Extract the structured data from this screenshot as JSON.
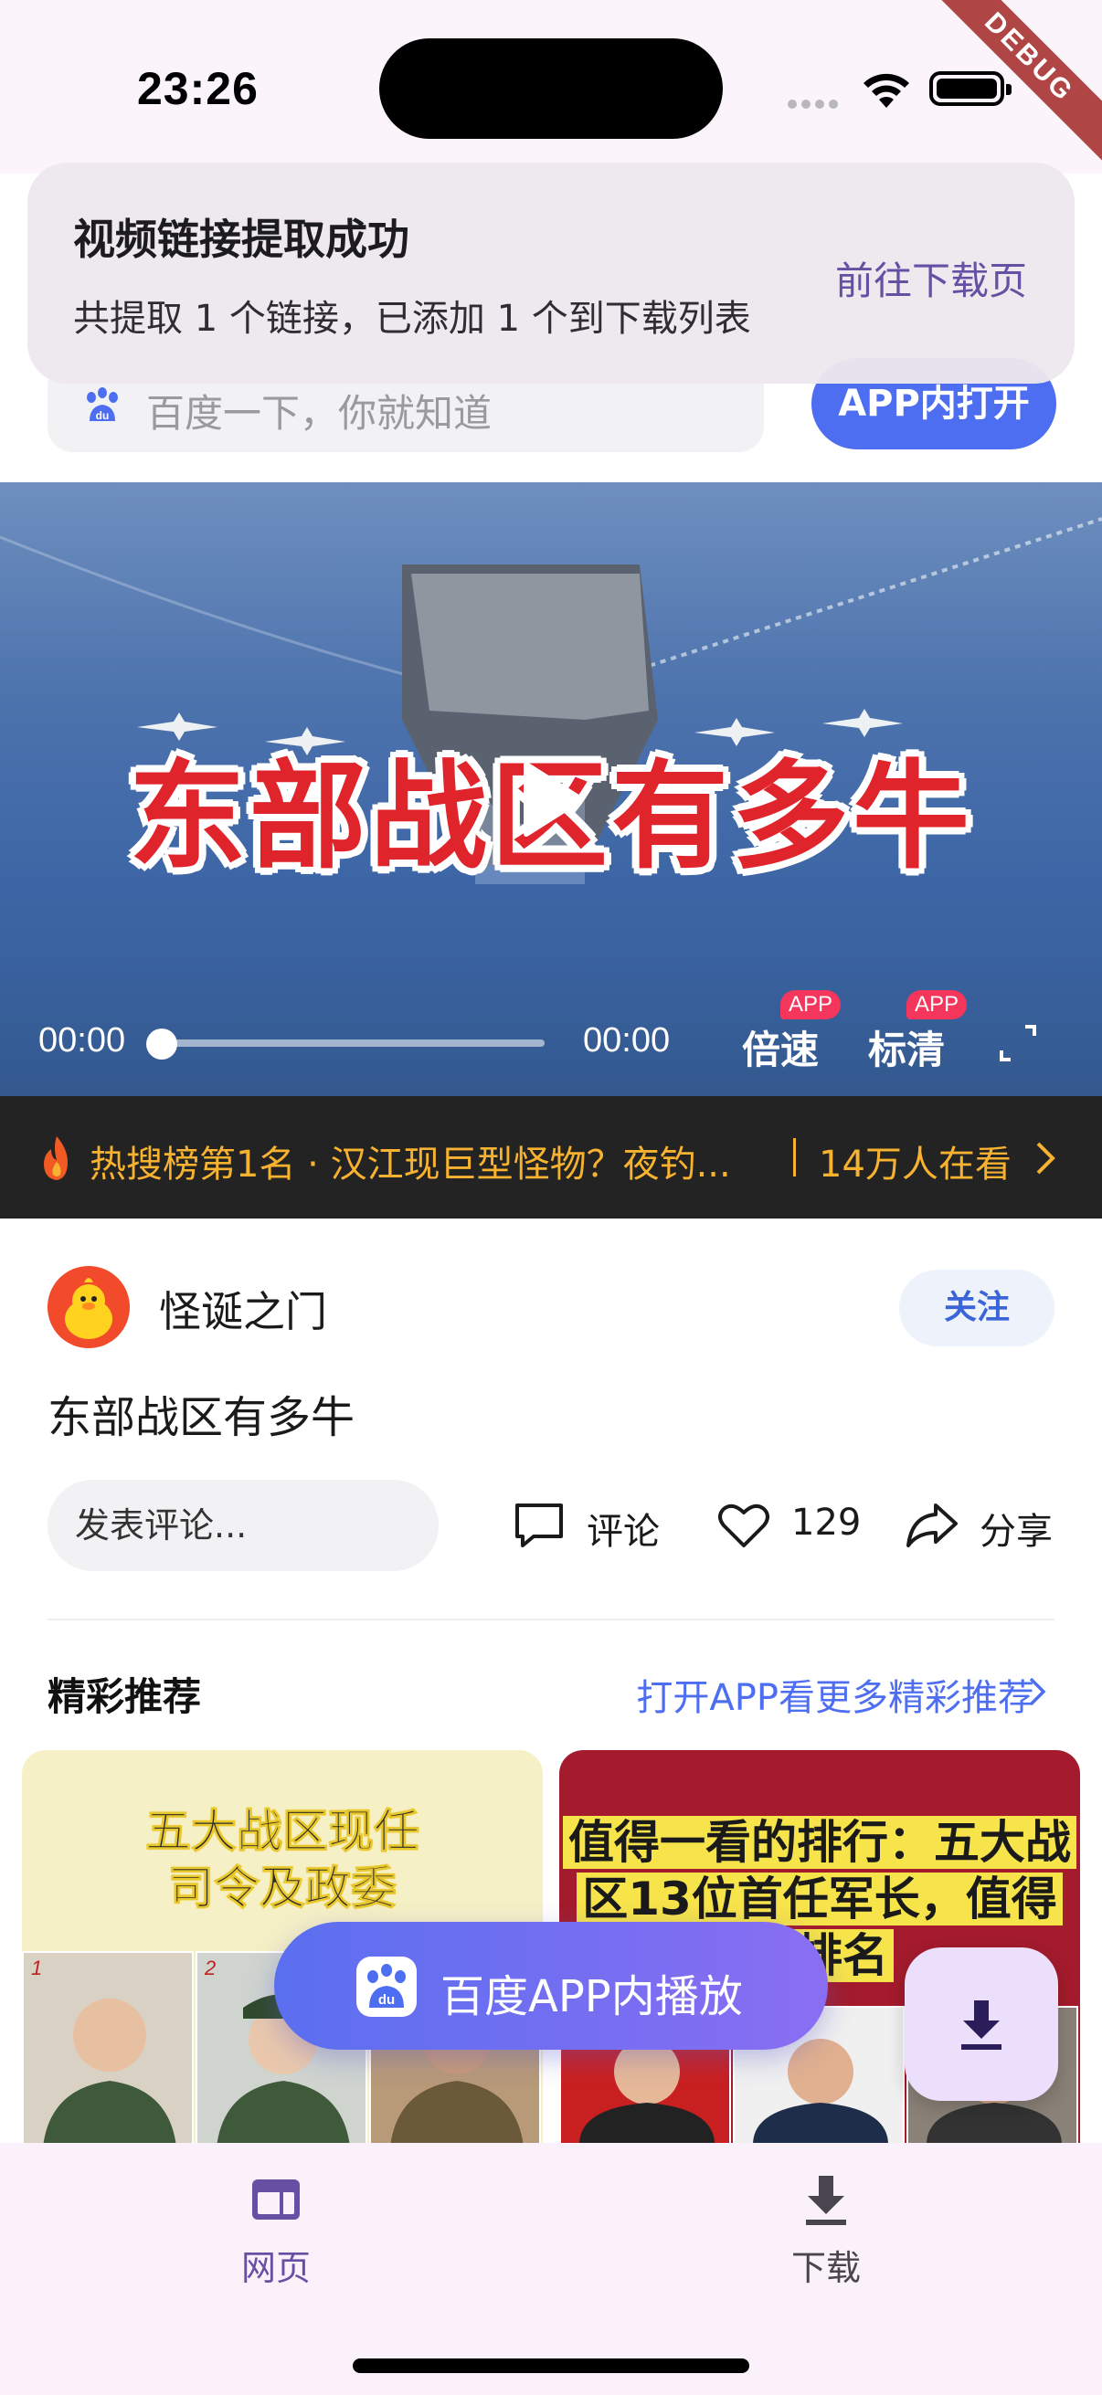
{
  "status_bar": {
    "time": "23:26",
    "debug_label": "DEBUG"
  },
  "toast": {
    "title": "视频链接提取成功",
    "message": "共提取 1 个链接，已添加 1 个到下载列表",
    "action": "前往下载页"
  },
  "search": {
    "placeholder": "百度一下，你就知道",
    "open_app": "APP内打开"
  },
  "video": {
    "headline": "东部战区有多牛",
    "current_time": "00:00",
    "duration": "00:00",
    "progress": 0,
    "speed_label": "倍速",
    "quality_label": "标清",
    "app_tag": "APP"
  },
  "hot_bar": {
    "text": "热搜榜第1名 · 汉江现巨型怪物？夜钓...",
    "viewers": "14万人在看"
  },
  "post": {
    "author": "怪诞之门",
    "follow": "关注",
    "title": "东部战区有多牛",
    "comment_placeholder": "发表评论...",
    "comment_label": "评论",
    "like_count": "129",
    "share_label": "分享"
  },
  "recommend": {
    "title": "精彩推荐",
    "more": "打开APP看更多精彩推荐",
    "cards": [
      {
        "caption_line1": "五大战区现任",
        "caption_line2": "司令及政委",
        "badge1": "1",
        "badge2": "2"
      },
      {
        "caption_line1": "值得一看的排行：五大战",
        "caption_line2": "区13位首任军长，值得",
        "caption_line3": "的排名"
      }
    ]
  },
  "floating": {
    "play_in_app": "百度APP内播放"
  },
  "bottom_nav": {
    "web": "网页",
    "download": "下载"
  },
  "colors": {
    "accent": "#4e6ef2",
    "primary": "#6650a4",
    "hot": "#f7b230",
    "headline_red": "#e0242b"
  }
}
